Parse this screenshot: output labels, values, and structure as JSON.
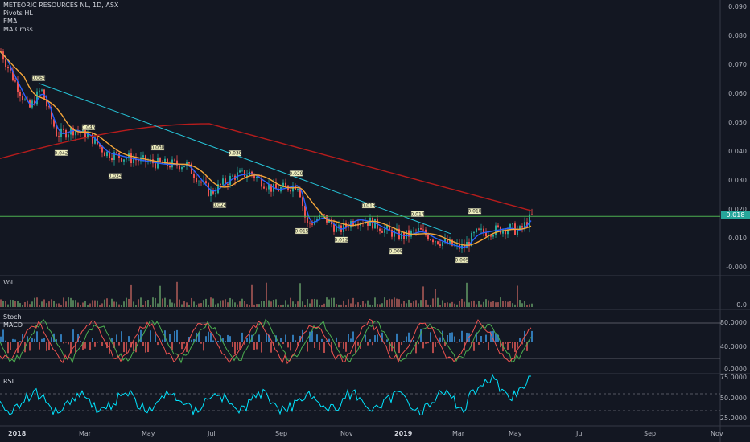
{
  "header": {
    "title": "METEORIC RESOURCES NL, 1D, ASX",
    "indicators": [
      "Pivots HL",
      "EMA",
      "MA Cross"
    ]
  },
  "colors": {
    "background": "#131722",
    "up": "#26a69a",
    "down": "#ef5350",
    "ema": "#2962ff",
    "ma_fast": "#f4a63a",
    "ma_slow": "#b71c1c",
    "trendline": "#26c6da",
    "price_line": "#4caf50",
    "stoch_k": "#4caf50",
    "stoch_d": "#ef5350",
    "rsi": "#00e5ff",
    "grid": "#2a2e39"
  },
  "price_axis": {
    "labels": [
      "0.090",
      "0.080",
      "0.070",
      "0.060",
      "0.050",
      "0.040",
      "0.030",
      "0.020",
      "0.010",
      "-0.000"
    ],
    "current_price": "0.018"
  },
  "volume_panel": {
    "label": "Vol",
    "axis_labels": [
      "0.0"
    ]
  },
  "oscillator_panel": {
    "labels": [
      "Stoch",
      "MACD"
    ],
    "axis_labels": [
      "80.0000",
      "40.0000",
      "0.0000"
    ]
  },
  "rsi_panel": {
    "label": "RSI",
    "axis_labels": [
      "75.0000",
      "50.0000",
      "25.0000"
    ]
  },
  "time_axis": {
    "labels": [
      "2018",
      "Mar",
      "May",
      "Jul",
      "Sep",
      "Nov",
      "2019",
      "Mar",
      "May",
      "Jul",
      "Sep",
      "Nov"
    ]
  },
  "pivots": [
    {
      "label": "0.064",
      "type": "high"
    },
    {
      "label": "0.042",
      "type": "low"
    },
    {
      "label": "0.045",
      "type": "high"
    },
    {
      "label": "0.034",
      "type": "low"
    },
    {
      "label": "0.038",
      "type": "high"
    },
    {
      "label": "0.024",
      "type": "low"
    },
    {
      "label": "0.038",
      "type": "high"
    },
    {
      "label": "0.029",
      "type": "high"
    },
    {
      "label": "0.015",
      "type": "low"
    },
    {
      "label": "0.012",
      "type": "low"
    },
    {
      "label": "0.019",
      "type": "high"
    },
    {
      "label": "0.008",
      "type": "low"
    },
    {
      "label": "0.014",
      "type": "high"
    },
    {
      "label": "0.005",
      "type": "low"
    },
    {
      "label": "0.018",
      "type": "high"
    }
  ]
}
